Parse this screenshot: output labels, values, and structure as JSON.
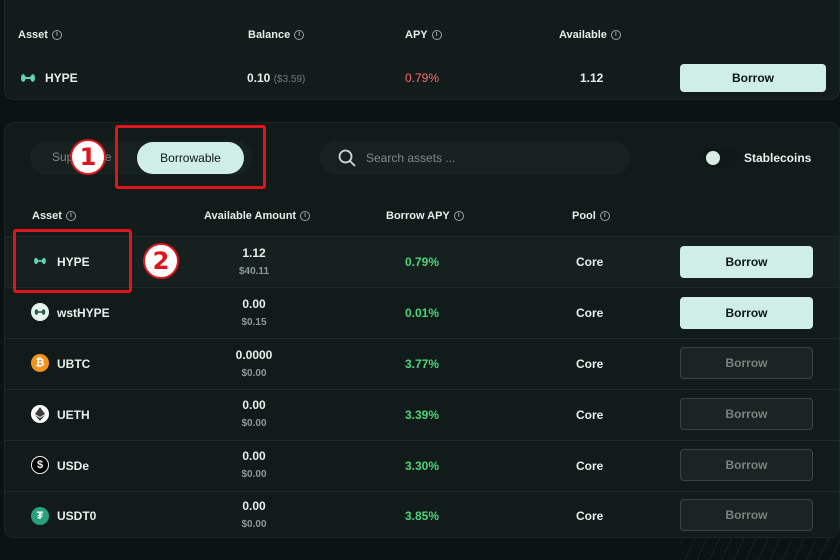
{
  "top_table": {
    "headers": {
      "asset": "Asset",
      "balance": "Balance",
      "apy": "APY",
      "available": "Available"
    },
    "row": {
      "asset": "HYPE",
      "balance": "0.10",
      "balance_usd": "($3.59)",
      "apy": "0.79%",
      "available": "1.12",
      "button": "Borrow"
    }
  },
  "tabs": {
    "supply": "Supplyable",
    "borrowable": "Borrowable"
  },
  "search": {
    "placeholder": "Search assets ..."
  },
  "toggle": {
    "label": "Stablecoins"
  },
  "table": {
    "headers": {
      "asset": "Asset",
      "available_amount": "Available Amount",
      "borrow_apy": "Borrow APY",
      "pool": "Pool"
    },
    "rows": [
      {
        "asset": "HYPE",
        "amount": "1.12",
        "amount_usd": "$40.11",
        "apy": "0.79%",
        "pool": "Core",
        "button": "Borrow",
        "icon": "hype-icon",
        "color": "#5fd4b4"
      },
      {
        "asset": "wstHYPE",
        "amount": "0.00",
        "amount_usd": "$0.15",
        "apy": "0.01%",
        "pool": "Core",
        "button": "Borrow",
        "icon": "wsthype-icon",
        "color": "#2a5a50"
      },
      {
        "asset": "UBTC",
        "amount": "0.0000",
        "amount_usd": "$0.00",
        "apy": "3.77%",
        "pool": "Core",
        "button": "Borrow",
        "icon": "bitcoin-icon",
        "color": "#f7931a"
      },
      {
        "asset": "UETH",
        "amount": "0.00",
        "amount_usd": "$0.00",
        "apy": "3.39%",
        "pool": "Core",
        "button": "Borrow",
        "icon": "ethereum-icon",
        "color": "#ffffff"
      },
      {
        "asset": "USDe",
        "amount": "0.00",
        "amount_usd": "$0.00",
        "apy": "3.30%",
        "pool": "Core",
        "button": "Borrow",
        "icon": "usde-icon",
        "color": "#000000"
      },
      {
        "asset": "USDT0",
        "amount": "0.00",
        "amount_usd": "$0.00",
        "apy": "3.85%",
        "pool": "Core",
        "button": "Borrow",
        "icon": "usdt0-icon",
        "color": "#26a17b"
      }
    ]
  },
  "annotations": {
    "one": "1",
    "two": "2"
  },
  "colors": {
    "accent": "#cfeee6",
    "positive": "#4ed37a",
    "negative": "#ff6b6b",
    "annotation": "#e0151b"
  }
}
